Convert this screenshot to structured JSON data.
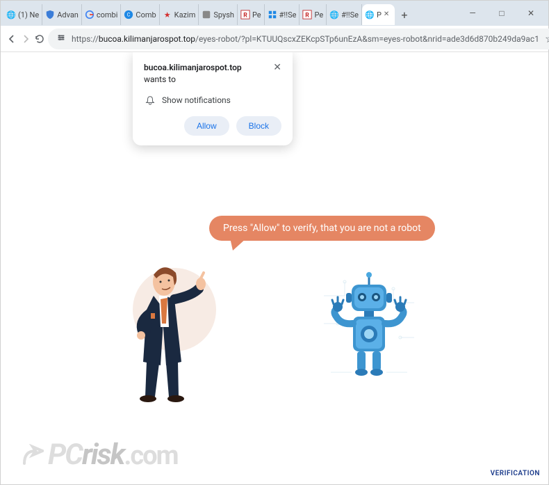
{
  "window": {
    "tabs": [
      {
        "icon": "globe",
        "label": "(1) Ne"
      },
      {
        "icon": "shield-blue",
        "label": "Advan"
      },
      {
        "icon": "google",
        "label": "combi"
      },
      {
        "icon": "cc-blue",
        "label": "Comb"
      },
      {
        "icon": "star-red",
        "label": "Kazim"
      },
      {
        "icon": "cc-gray",
        "label": "Spysh"
      },
      {
        "icon": "r-red",
        "label": "Pe"
      },
      {
        "icon": "grid-blue",
        "label": "#!!Se"
      },
      {
        "icon": "r-red",
        "label": "Pe"
      },
      {
        "icon": "globe",
        "label": "#!!Se"
      },
      {
        "icon": "globe",
        "label": "P",
        "active": true
      }
    ],
    "controls": {
      "minimize": "—",
      "maximize": "□",
      "close": "✕"
    }
  },
  "toolbar": {
    "url_protocol": "https://",
    "url_domain": "bucoa.kilimanjarospot.top",
    "url_path": "/eyes-robot/?pl=KTUUQscxZEKcpSTp6unEzA&sm=eyes-robot&nrid=ade3d6d870b249da9ac1"
  },
  "permission": {
    "site": "bucoa.kilimanjarospot.top",
    "wants_to": "wants to",
    "body": "Show notifications",
    "allow": "Allow",
    "block": "Block"
  },
  "page": {
    "bubble_text": "Press \"Allow\" to verify, that you are not a robot",
    "verification": "VERIFICATION"
  },
  "watermark": {
    "pc": "PC",
    "risk": "risk",
    "com": ".com"
  }
}
